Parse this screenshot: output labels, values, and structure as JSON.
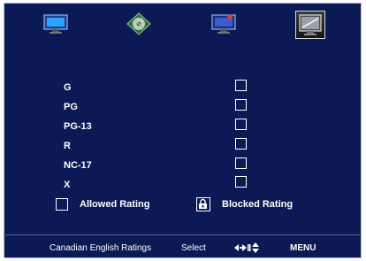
{
  "tabs": [
    {
      "name": "picture-tv-icon",
      "selected": false
    },
    {
      "name": "audio-disc-icon",
      "selected": false
    },
    {
      "name": "setup-tv-icon",
      "selected": false
    },
    {
      "name": "lock-tv-icon",
      "selected": true
    }
  ],
  "ratings": [
    {
      "label": "G",
      "blocked": false
    },
    {
      "label": "PG",
      "blocked": false
    },
    {
      "label": "PG-13",
      "blocked": false
    },
    {
      "label": "R",
      "blocked": false
    },
    {
      "label": "NC-17",
      "blocked": false
    },
    {
      "label": "X",
      "blocked": false
    }
  ],
  "legend": {
    "allowed_label": "Allowed Rating",
    "blocked_label": "Blocked Rating"
  },
  "footer": {
    "title": "Canadian English Ratings",
    "select_label": "Select",
    "nav_hint_icon": "arrow-keys-icon",
    "menu_label": "MENU"
  },
  "colors": {
    "background": "#0b1a54",
    "text": "#ffffff"
  }
}
